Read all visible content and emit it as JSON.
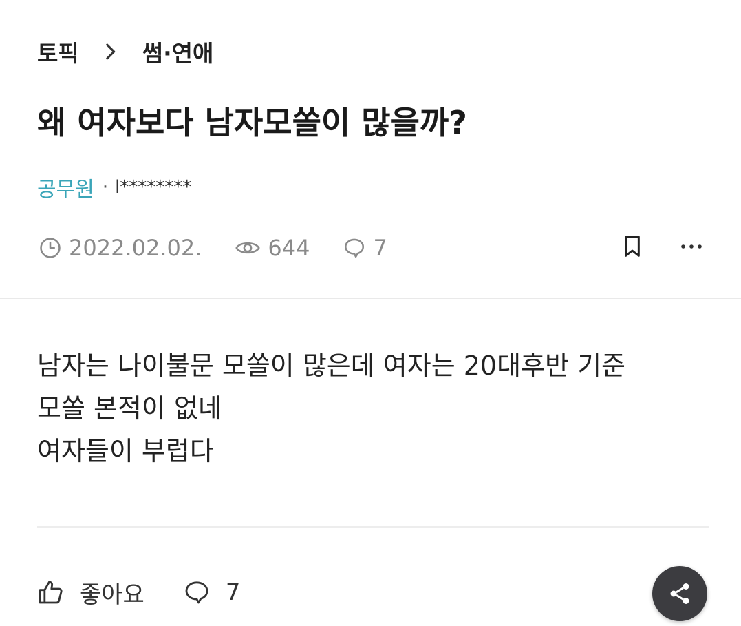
{
  "breadcrumb": {
    "root": "토픽",
    "current": "썸·연애"
  },
  "post": {
    "title": "왜 여자보다 남자모쏠이 많을까?",
    "author_job": "공무원",
    "author_separator": "·",
    "author_nick": "l********",
    "date": "2022.02.02.",
    "views": "644",
    "comments": "7",
    "body_lines": [
      "남자는 나이불문 모쏠이 많은데 여자는 20대후반 기준",
      "모쏠 본적이 없네",
      "여자들이 부럽다"
    ]
  },
  "actions": {
    "like_label": "좋아요",
    "comment_count": "7"
  },
  "icons": {
    "breadcrumb_chevron": "chevron-right-icon",
    "date": "clock-icon",
    "views": "eye-icon",
    "comments": "speech-bubble-icon",
    "bookmark": "bookmark-icon",
    "more": "more-horizontal-icon",
    "like": "thumbs-up-icon",
    "share": "share-icon"
  },
  "colors": {
    "author_job": "#3aa5b8",
    "meta_text": "#8a8a8a",
    "share_button_bg": "#3c3c40"
  }
}
